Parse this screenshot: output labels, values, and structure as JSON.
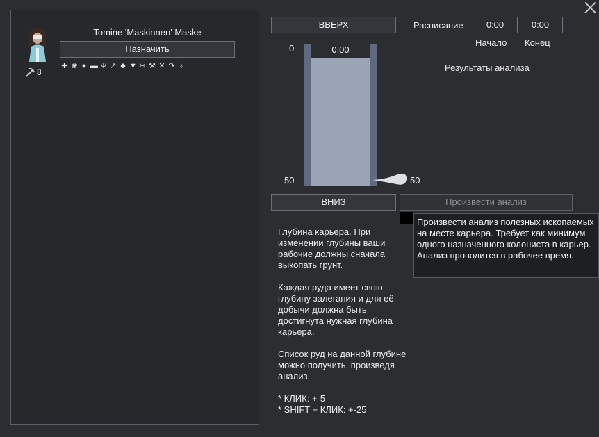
{
  "window": {
    "close_icon": "close-x-icon"
  },
  "colonist": {
    "name": "Tomine 'Maskinnen' Maske",
    "assign_label": "Назначить",
    "mining_skill": "8",
    "skill_icon": "pickaxe-icon",
    "work_icons": [
      "cross-icon",
      "paw-icon",
      "cloud-icon",
      "brick-icon",
      "sprout-icon",
      "pickaxe-icon",
      "plant-icon",
      "anvil-icon",
      "scissors-icon",
      "hammer-icon",
      "tools-icon",
      "redo-icon",
      "flask-icon"
    ]
  },
  "quarry": {
    "up_label": "ВВЕРХ",
    "down_label": "ВНИЗ",
    "depth_current": "0.00",
    "depth_min_label": "0",
    "depth_max_label": "50",
    "handle_value_label": "50",
    "depth_fraction": 0.0,
    "target_fraction": 1.0,
    "analyze_label": "Произвести анализ"
  },
  "schedule": {
    "label": "Расписание",
    "start_value": "0:00",
    "end_value": "0:00",
    "start_label": "Начало",
    "end_label": "Конец"
  },
  "results": {
    "title": "Результаты анализа"
  },
  "description": [
    "Глубина карьера. При изменении глубины ваши рабочие должны сначала выкопать грунт.",
    "Каждая руда имеет свою глубину залегания и для её добычи должна быть достигнута нужная глубина карьера.",
    "Список руд на данной глубине можно получить, произведя анализ.",
    "* КЛИК: +-5\n* SHIFT + КЛИК: +-25"
  ],
  "tooltip": {
    "text": "Произвести анализ полезных ископаемых на месте карьера. Требует как минимум одного назначенного колониста в карьер. Анализ проводится в рабочее время."
  },
  "colors": {
    "rail": "#5f6a80",
    "fill": "#9ba4b4",
    "background": "#2b2d31"
  }
}
